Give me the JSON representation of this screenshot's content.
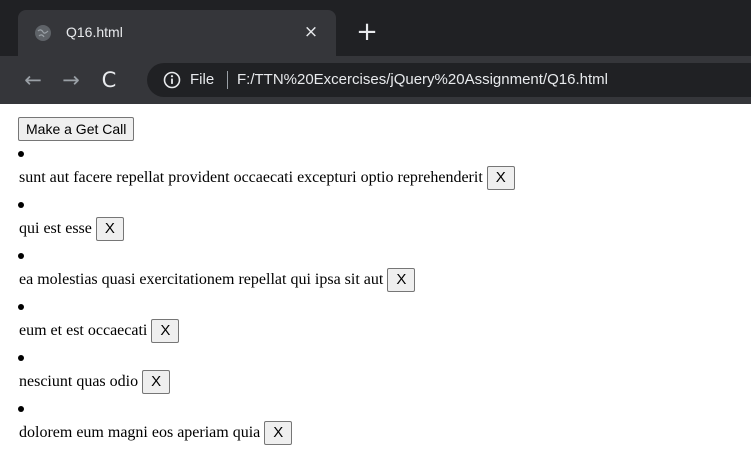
{
  "browser": {
    "tab": {
      "title": "Q16.html",
      "close_label": "×",
      "favicon_icon": "globe-icon"
    },
    "new_tab_label": "+",
    "nav": {
      "back_label": "←",
      "forward_label": "→",
      "reload_label": "C"
    },
    "omnibox": {
      "site_label": "File",
      "url": "F:/TTN%20Excercises/jQuery%20Assignment/Q16.html",
      "info_icon": "info-icon"
    },
    "colors": {
      "tabstrip": "#202124",
      "toolbar": "#35363a",
      "text": "#e8eaed"
    }
  },
  "page": {
    "get_button_label": "Make a Get Call",
    "posts": [
      {
        "title": "sunt aut facere repellat provident occaecati excepturi optio reprehenderit",
        "delete_label": "X"
      },
      {
        "title": "qui est esse",
        "delete_label": "X"
      },
      {
        "title": "ea molestias quasi exercitationem repellat qui ipsa sit aut",
        "delete_label": "X"
      },
      {
        "title": "eum et est occaecati",
        "delete_label": "X"
      },
      {
        "title": "nesciunt quas odio",
        "delete_label": "X"
      },
      {
        "title": "dolorem eum magni eos aperiam quia",
        "delete_label": "X"
      }
    ]
  }
}
